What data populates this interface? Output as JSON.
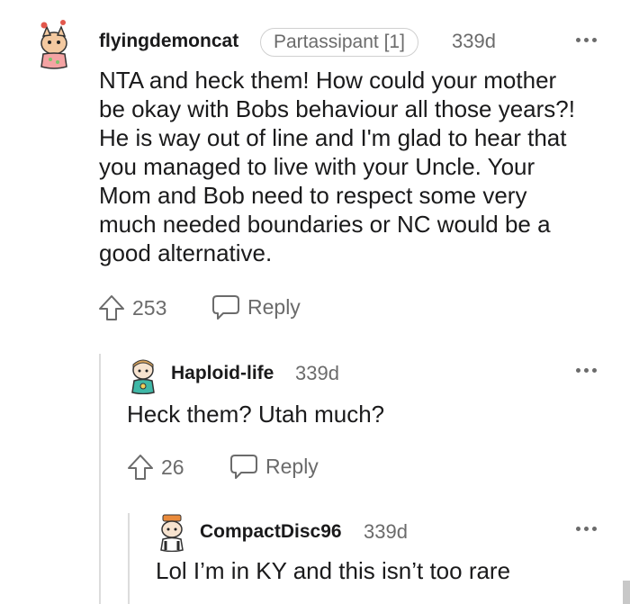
{
  "comments": [
    {
      "username": "flyingdemoncat",
      "flair": "Partassipant [1]",
      "age": "339d",
      "text_lines": [
        "NTA and heck them! How could your mother",
        "be okay with Bobs behaviour all those years?!",
        "He is way out of line and I'm glad to hear that",
        "you managed to live with your Uncle. Your",
        "Mom and Bob need to respect some very",
        "much needed boundaries or NC would be a",
        "good alternative."
      ],
      "votes": "253",
      "reply_label": "Reply"
    },
    {
      "username": "Haploid-life",
      "age": "339d",
      "text": "Heck them? Utah much?",
      "votes": "26",
      "reply_label": "Reply"
    },
    {
      "username": "CompactDisc96",
      "age": "339d",
      "text": "Lol I’m in KY and this isn’t too rare"
    }
  ],
  "icons": {
    "upvote": "upvote-arrow-icon",
    "reply": "speech-bubble-icon",
    "more": "more-options-icon",
    "avatar": "snoo-avatar-icon"
  }
}
